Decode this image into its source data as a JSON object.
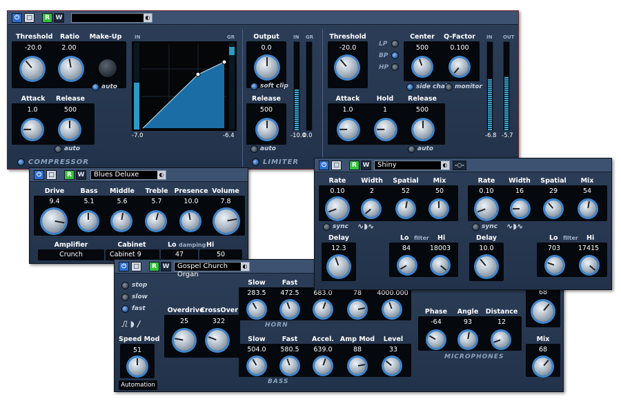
{
  "compressor": {
    "title": "COMPRESSOR",
    "limiter_title": "LIMITER",
    "threshold": {
      "label": "Threshold",
      "value": "-20.0"
    },
    "ratio": {
      "label": "Ratio",
      "value": "2.00"
    },
    "makeup": {
      "label": "Make-Up",
      "auto": "auto"
    },
    "attack": {
      "label": "Attack",
      "value": "1.0"
    },
    "release": {
      "label": "Release",
      "value": "500",
      "auto": "auto"
    },
    "graph": {
      "in_label": "IN",
      "gr_label": "GR",
      "in_value": "-7.0",
      "gr_value": "-6.4"
    },
    "output": {
      "label": "Output",
      "value": "0.0",
      "soft_clip": "soft clip",
      "in_label": "IN",
      "gr_label": "GR",
      "in_value": "-10.0",
      "gr_value": "0.0"
    },
    "limiter_release": {
      "label": "Release",
      "value": "500",
      "auto": "auto"
    }
  },
  "gate": {
    "threshold": {
      "label": "Threshold",
      "value": "-20.0"
    },
    "filters": [
      "LP",
      "BP",
      "HP"
    ],
    "center": {
      "label": "Center",
      "value": "500"
    },
    "qfactor": {
      "label": "Q-Factor",
      "value": "0.100"
    },
    "side_chain": "side chain",
    "monitor": "monitor",
    "attack": {
      "label": "Attack",
      "value": "1.0"
    },
    "hold": {
      "label": "Hold",
      "value": "1"
    },
    "release": {
      "label": "Release",
      "value": "500",
      "auto": "auto"
    },
    "in_label": "IN",
    "out_label": "OUT",
    "in_value": "-6.8",
    "out_value": "-5.7"
  },
  "amp": {
    "preset": "Blues Deluxe",
    "knobs": [
      {
        "label": "Drive",
        "value": "9.4"
      },
      {
        "label": "Bass",
        "value": "5.1"
      },
      {
        "label": "Middle",
        "value": "5.6"
      },
      {
        "label": "Treble",
        "value": "5.7"
      },
      {
        "label": "Presence",
        "value": "10.0"
      },
      {
        "label": "Volume",
        "value": "7.8"
      }
    ],
    "amplifier": {
      "label": "Amplifier",
      "value": "Crunch"
    },
    "cabinet": {
      "label": "Cabinet",
      "value": "Cabinet 9"
    },
    "damping": {
      "lo": "Lo",
      "mid": "damping",
      "hi": "Hi",
      "lo_value": "47",
      "hi_value": "50"
    }
  },
  "chorus": {
    "preset": "Shiny",
    "left": {
      "labels": [
        "Rate",
        "Width",
        "Spatial",
        "Mix"
      ],
      "values": [
        "0.10",
        "2",
        "52",
        "50"
      ],
      "sync": "sync",
      "delay": {
        "label": "Delay",
        "value": "12.3"
      },
      "filter": {
        "lo": "Lo",
        "mid": "filter",
        "hi": "Hi",
        "lo_value": "84",
        "hi_value": "18003"
      }
    },
    "right": {
      "labels": [
        "Rate",
        "Width",
        "Spatial",
        "Mix"
      ],
      "values": [
        "0.10",
        "16",
        "29",
        "54"
      ],
      "sync": "sync",
      "delay": {
        "label": "Delay",
        "value": "10.0"
      },
      "filter": {
        "lo": "Lo",
        "mid": "filter",
        "hi": "Hi",
        "lo_value": "703",
        "hi_value": "17415"
      }
    }
  },
  "rotary": {
    "preset": "Gospel Church Organ",
    "speed": [
      "stop",
      "slow",
      "fast"
    ],
    "speed_mod": {
      "label": "Speed Mod",
      "value": "51"
    },
    "automation": "Automation",
    "overdrive": {
      "label": "Overdrive",
      "value": "25"
    },
    "crossover": {
      "label": "CrossOver",
      "value": "322"
    },
    "horn": {
      "title": "HORN",
      "labels": [
        "Slow",
        "Fast"
      ],
      "values": [
        "283.5",
        "472.5",
        "683.0",
        "78",
        "4000.000"
      ]
    },
    "bass": {
      "title": "BASS",
      "labels": [
        "Slow",
        "Fast",
        "Accel.",
        "Amp Mod",
        "Level"
      ],
      "values": [
        "504.0",
        "580.5",
        "639.0",
        "88",
        "33"
      ]
    },
    "mic": {
      "title": "MICROPHONES",
      "labels": [
        "Phase",
        "Angle",
        "Distance"
      ],
      "values": [
        "-64",
        "93",
        "12"
      ]
    },
    "top_value": "68",
    "mix": {
      "label": "Mix",
      "value": "68"
    }
  }
}
